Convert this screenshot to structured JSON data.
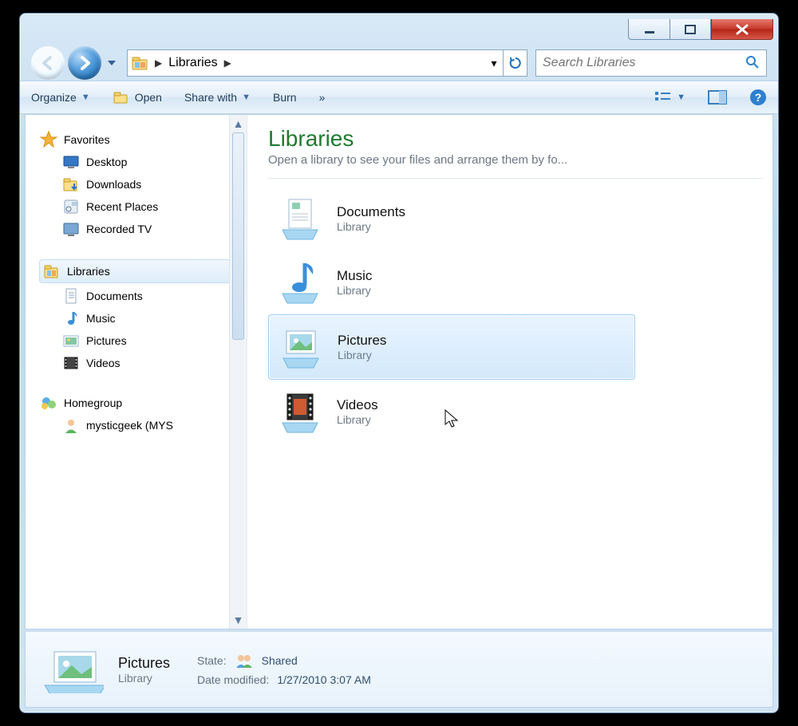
{
  "breadcrumb": {
    "root_sep": "▶",
    "location": "Libraries",
    "sep2": "▶"
  },
  "search": {
    "placeholder": "Search Libraries"
  },
  "toolbar": {
    "organize": "Organize",
    "open": "Open",
    "share": "Share with",
    "burn": "Burn",
    "overflow": "»"
  },
  "nav": {
    "favorites": "Favorites",
    "favorites_items": [
      "Desktop",
      "Downloads",
      "Recent Places",
      "Recorded TV"
    ],
    "libraries": "Libraries",
    "libraries_items": [
      "Documents",
      "Music",
      "Pictures",
      "Videos"
    ],
    "homegroup": "Homegroup",
    "homegroup_items": [
      "mysticgeek (MYS"
    ]
  },
  "content": {
    "title": "Libraries",
    "subtitle": "Open a library to see your files and arrange them by fo...",
    "items": [
      {
        "name": "Documents",
        "type": "Library"
      },
      {
        "name": "Music",
        "type": "Library"
      },
      {
        "name": "Pictures",
        "type": "Library",
        "selected": true
      },
      {
        "name": "Videos",
        "type": "Library"
      }
    ]
  },
  "details": {
    "name": "Pictures",
    "type": "Library",
    "state_label": "State:",
    "state_value": "Shared",
    "mod_label": "Date modified:",
    "mod_value": "1/27/2010 3:07 AM"
  }
}
